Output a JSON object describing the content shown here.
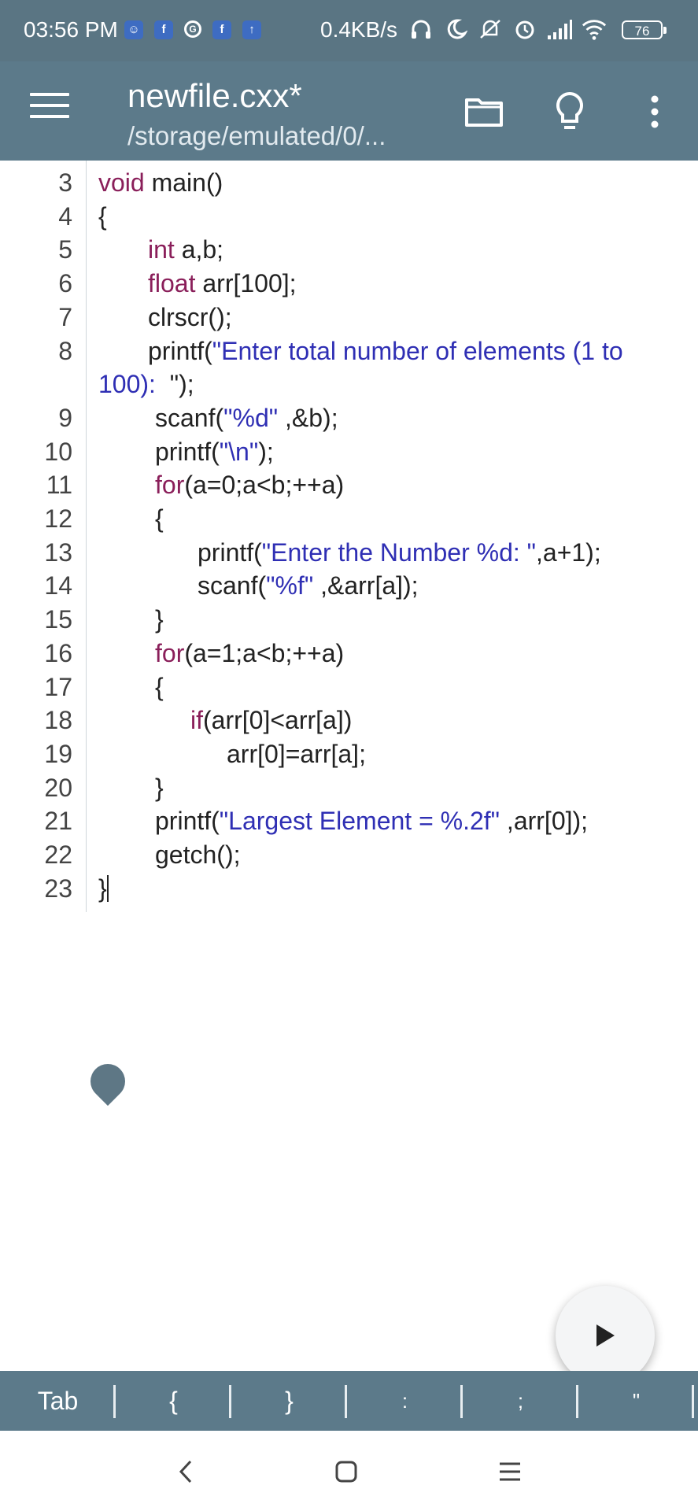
{
  "status_bar": {
    "time": "03:56 PM",
    "net_speed": "0.4KB/s",
    "battery": "76",
    "notification_icons": [
      "discord-icon",
      "facebook-icon",
      "google-icon",
      "facebook-icon",
      "upload-icon"
    ],
    "system_icons": [
      "headphones-icon",
      "moon-icon",
      "mute-icon",
      "alarm-icon",
      "signal-icon",
      "wifi-icon",
      "battery-icon"
    ]
  },
  "toolbar": {
    "title": "newfile.cxx*",
    "subtitle": "/storage/emulated/0/...",
    "icons": [
      "menu-icon",
      "folder-icon",
      "lightbulb-icon",
      "more-vertical-icon"
    ]
  },
  "editor": {
    "lines": [
      {
        "n": "3",
        "segs": [
          {
            "t": "void",
            "c": "kw"
          },
          {
            "t": " main()",
            "c": ""
          }
        ]
      },
      {
        "n": "4",
        "segs": [
          {
            "t": "{",
            "c": ""
          }
        ]
      },
      {
        "n": "5",
        "segs": [
          {
            "t": "int",
            "c": "kw"
          },
          {
            "t": " a,b;",
            "c": ""
          }
        ]
      },
      {
        "n": "6",
        "segs": [
          {
            "t": "float",
            "c": "kw"
          },
          {
            "t": " arr[100];",
            "c": ""
          }
        ]
      },
      {
        "n": "7",
        "segs": [
          {
            "t": "clrscr();",
            "c": ""
          }
        ]
      },
      {
        "n": "8",
        "segs": [
          {
            "t": "printf(",
            "c": ""
          },
          {
            "t": "\"Enter total number of elements (1 to",
            "c": "str"
          }
        ]
      },
      {
        "n": "",
        "segs": [
          {
            "t": "100): ",
            "c": "str"
          },
          {
            "t": " \");",
            "c": ""
          }
        ]
      },
      {
        "n": "9",
        "segs": [
          {
            "t": "scanf(",
            "c": ""
          },
          {
            "t": "\"%d\"",
            "c": "str"
          },
          {
            "t": " ,&b);",
            "c": ""
          }
        ]
      },
      {
        "n": "10",
        "segs": [
          {
            "t": "printf(",
            "c": ""
          },
          {
            "t": "\"\\n\"",
            "c": "str"
          },
          {
            "t": ");",
            "c": ""
          }
        ]
      },
      {
        "n": "11",
        "segs": [
          {
            "t": "for",
            "c": "kw"
          },
          {
            "t": "(a=0;a<b;++a)",
            "c": ""
          }
        ]
      },
      {
        "n": "12",
        "segs": [
          {
            "t": "{",
            "c": ""
          }
        ]
      },
      {
        "n": "13",
        "segs": [
          {
            "t": "printf(",
            "c": ""
          },
          {
            "t": "\"Enter the Number %d: \"",
            "c": "str"
          },
          {
            "t": ",a+1);",
            "c": ""
          }
        ]
      },
      {
        "n": "14",
        "segs": [
          {
            "t": "scanf(",
            "c": ""
          },
          {
            "t": "\"%f\"",
            "c": "str"
          },
          {
            "t": " ,&arr[a]);",
            "c": ""
          }
        ]
      },
      {
        "n": "15",
        "segs": [
          {
            "t": "}",
            "c": ""
          }
        ]
      },
      {
        "n": "16",
        "segs": [
          {
            "t": "for",
            "c": "kw"
          },
          {
            "t": "(a=1;a<b;++a)",
            "c": ""
          }
        ]
      },
      {
        "n": "17",
        "segs": [
          {
            "t": "{",
            "c": ""
          }
        ]
      },
      {
        "n": "18",
        "segs": [
          {
            "t": "if",
            "c": "kw"
          },
          {
            "t": "(arr[0]<arr[a])",
            "c": ""
          }
        ]
      },
      {
        "n": "19",
        "segs": [
          {
            "t": "arr[0]=arr[a];",
            "c": ""
          }
        ]
      },
      {
        "n": "20",
        "segs": [
          {
            "t": "}",
            "c": ""
          }
        ]
      },
      {
        "n": "21",
        "segs": [
          {
            "t": "printf(",
            "c": ""
          },
          {
            "t": "\"Largest Element = %.2f\"",
            "c": "str"
          },
          {
            "t": " ,arr[0]);",
            "c": ""
          }
        ]
      },
      {
        "n": "22",
        "segs": [
          {
            "t": "getch();",
            "c": ""
          }
        ]
      },
      {
        "n": "23",
        "segs": [
          {
            "t": "}",
            "c": ""
          }
        ]
      }
    ],
    "run_icon": "play-icon"
  },
  "symbol_bar": {
    "keys": [
      "Tab",
      "{",
      "}",
      ":",
      ";",
      "\""
    ]
  },
  "nav_bar": {
    "icons": [
      "back-icon",
      "home-icon",
      "recents-icon"
    ]
  },
  "colors": {
    "status_bg": "#5a7583",
    "toolbar_bg": "#5c7a8a",
    "keyword": "#8a1f5a",
    "string": "#2f2fb4",
    "code_text": "#222222",
    "line_number": "#444444"
  }
}
